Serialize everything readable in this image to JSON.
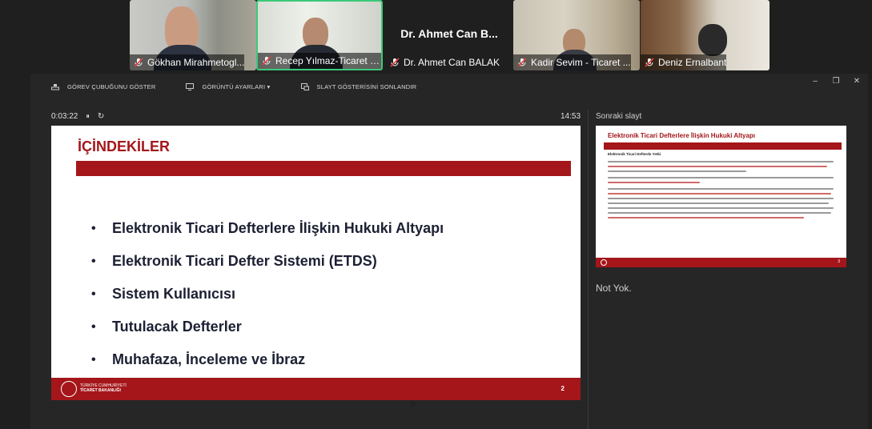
{
  "participants": [
    {
      "name": "Gökhan Mirahmetogl...",
      "muted": true,
      "active": false
    },
    {
      "name": "Recep Yılmaz-Ticaret Ba...",
      "muted": true,
      "active": true
    },
    {
      "name": "Dr. Ahmet Can BALAK",
      "display_name": "Dr. Ahmet Can B...",
      "muted": true,
      "active": false
    },
    {
      "name": "Kadir Sevim - Ticaret ...",
      "muted": true,
      "active": false
    },
    {
      "name": "Deniz Ernalbant",
      "muted": true,
      "active": false
    }
  ],
  "toolbar": {
    "taskbar_label": "GÖREV ÇUBUĞUNU GÖSTER",
    "display_label": "GÖRÜNTÜ AYARLARI ▾",
    "end_label": "SLAYT GÖSTERİSİNİ SONLANDIR"
  },
  "window_controls": {
    "minimize": "–",
    "restore": "❐",
    "close": "✕"
  },
  "timer": {
    "elapsed": "0:03:22",
    "pause": "⏸",
    "reset": "↻"
  },
  "clock": "14:53",
  "next_slide_label": "Sonraki slayt",
  "slide": {
    "title": "İÇİNDEKİLER",
    "bullets": [
      "Elektronik Ticari Defterlere İlişkin Hukuki Altyapı",
      "Elektronik Ticari Defter Sistemi (ETDS)",
      "Sistem Kullanıcısı",
      "Tutulacak Defterler",
      "Muhafaza, İnceleme ve İbraz"
    ],
    "footer_org": [
      "TÜRKİYE CUMHURİYETİ",
      "TİCARET BAKANLIĞI"
    ],
    "page_number": "2"
  },
  "next_slide": {
    "title": "Elektronik Ticari Defterlere İlişkin Hukuki Altyapı",
    "subtitle": "Elektronik Ticari Defterde Yetki",
    "page_number": "3"
  },
  "notes": "Not Yok.",
  "colors": {
    "brand_red": "#a4161a",
    "active_border": "#3cc97a",
    "muted_icon": "#e04040"
  }
}
